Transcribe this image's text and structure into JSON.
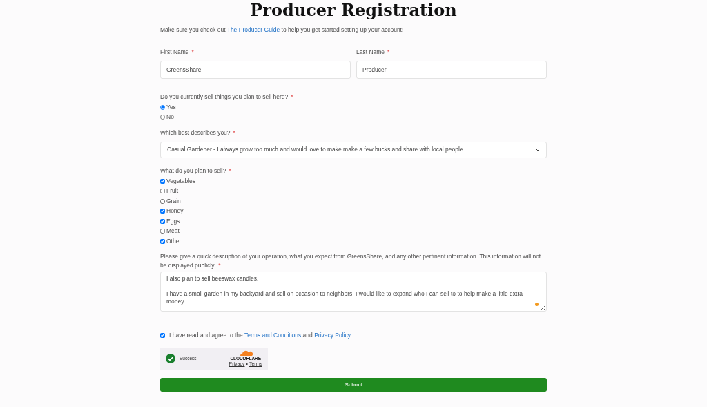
{
  "title": "Producer Registration",
  "intro": {
    "before": "Make sure you check out ",
    "link": "The Producer Guide",
    "after": " to help you get started setting up your account!"
  },
  "name_fields": [
    {
      "label": "First Name",
      "required_mark": "*",
      "value": "GreensShare"
    },
    {
      "label": "Last Name",
      "required_mark": "*",
      "value": "Producer"
    }
  ],
  "sell_question": {
    "label": "Do you currently sell things you plan to sell here?",
    "required_mark": "*",
    "options": [
      {
        "label": "Yes",
        "selected": true
      },
      {
        "label": "No",
        "selected": false
      }
    ]
  },
  "describe_select": {
    "label": "Which best describes you?",
    "required_mark": "*",
    "value": "Casual Gardener - I always grow too much and would love to make make a few bucks and share with local people"
  },
  "products": {
    "label": "What do you plan to sell?",
    "required_mark": "*",
    "options": [
      {
        "label": "Vegetables",
        "checked": true
      },
      {
        "label": "Fruit",
        "checked": false
      },
      {
        "label": "Grain",
        "checked": false
      },
      {
        "label": "Honey",
        "checked": true
      },
      {
        "label": "Eggs",
        "checked": true
      },
      {
        "label": "Meat",
        "checked": false
      },
      {
        "label": "Other",
        "checked": true
      }
    ]
  },
  "description": {
    "label": "Please give a quick description of your operation, what you expect from GreensShare, and any other pertinent information. This information will not be displayed publicly.",
    "required_mark": "*",
    "value": "I also plan to sell beeswax candles.\n\nI have a small garden in my backyard and sell on occasion to neighbors. I would like to expand who I can sell to to help make a little extra money."
  },
  "agree": {
    "checked": true,
    "before": "I have read and agree to the ",
    "link_1": "Terms and Conditions",
    "middle": " and ",
    "link_2": "Privacy Policy"
  },
  "captcha": {
    "status": "Success!",
    "brand": "CLOUDFLARE",
    "privacy": "Privacy",
    "separator": "•",
    "terms": "Terms"
  },
  "submit": "Submit"
}
